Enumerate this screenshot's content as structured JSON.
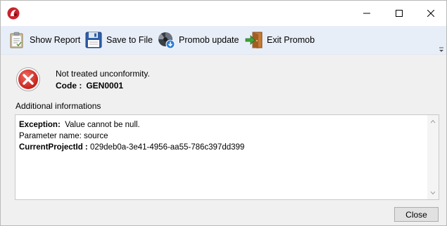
{
  "titlebar": {
    "icon": "promob-logo-icon",
    "controls": {
      "minimize": "minimize-icon",
      "maximize": "maximize-icon",
      "close": "close-icon"
    }
  },
  "toolbar": {
    "items": [
      {
        "label": "Show Report",
        "icon": "report-clipboard-icon"
      },
      {
        "label": "Save to File",
        "icon": "floppy-disk-icon"
      },
      {
        "label": "Promob update",
        "icon": "update-download-icon"
      },
      {
        "label": "Exit Promob",
        "icon": "exit-door-icon"
      }
    ],
    "overflow_icon": "overflow-chevron-icon"
  },
  "message": {
    "icon": "error-x-icon",
    "text": "Not treated unconformity.",
    "code_label": "Code :",
    "code_value": "GEN0001"
  },
  "details": {
    "label": "Additional informations",
    "exception_label": "Exception:",
    "exception_text": "Value cannot be null.",
    "parameter_line": "Parameter name: source",
    "project_label": "CurrentProjectId :",
    "project_value": "029deb0a-3e41-4956-aa55-786c397dd399"
  },
  "buttons": {
    "close_label": "Close"
  },
  "colors": {
    "toolbar_bg": "#e8eef8",
    "error_red": "#d9322b",
    "window_bg": "#f0f0f0"
  }
}
